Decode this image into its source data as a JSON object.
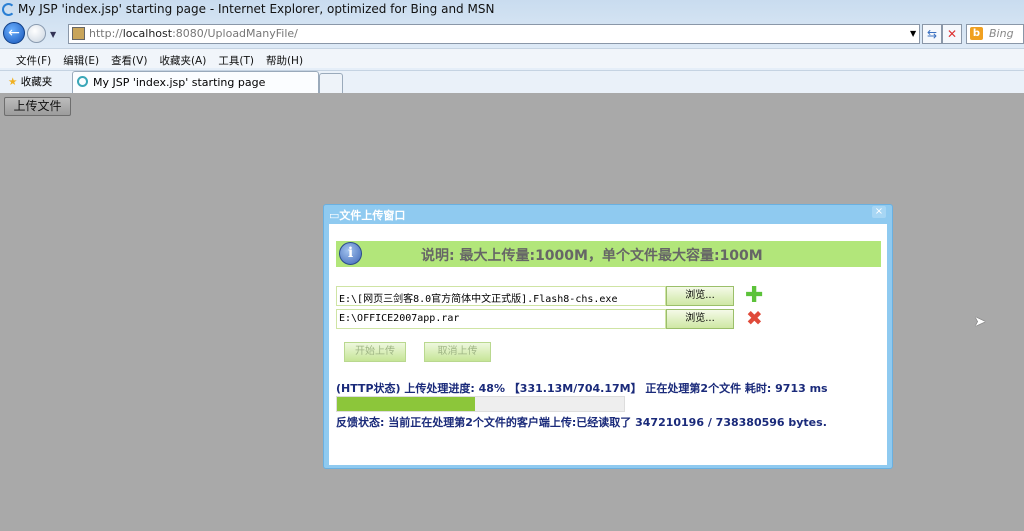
{
  "window": {
    "title": "My JSP 'index.jsp' starting page - Internet Explorer, optimized for Bing and MSN"
  },
  "address": {
    "scheme": "http://",
    "host": "localhost",
    "rest": ":8080/UploadManyFile/"
  },
  "search": {
    "provider": "Bing"
  },
  "menu": [
    "文件(F)",
    "编辑(E)",
    "查看(V)",
    "收藏夹(A)",
    "工具(T)",
    "帮助(H)"
  ],
  "favorites_label": "收藏夹",
  "tab": {
    "label": "My JSP 'index.jsp' starting page"
  },
  "page": {
    "upload_button": "上传文件"
  },
  "dialog": {
    "title": "文件上传窗口",
    "close": "×",
    "info": "说明:  最大上传量:1000M，单个文件最大容量:100M",
    "files": [
      {
        "path": "E:\\[网页三剑客8.0官方简体中文正式版].Flash8-chs.exe",
        "browse": "浏览..."
      },
      {
        "path": "E:\\OFFICE2007app.rar",
        "browse": "浏览..."
      }
    ],
    "start_button": "开始上传",
    "cancel_button": "取消上传",
    "progress_text": "(HTTP状态) 上传处理进度: 48% 【331.13M/704.17M】  正在处理第2个文件  耗时: 9713 ms",
    "progress_percent": 48,
    "feedback_text": "反馈状态: 当前正在处理第2个文件的客户端上传:已经读取了  347210196 / 738380596 bytes."
  }
}
